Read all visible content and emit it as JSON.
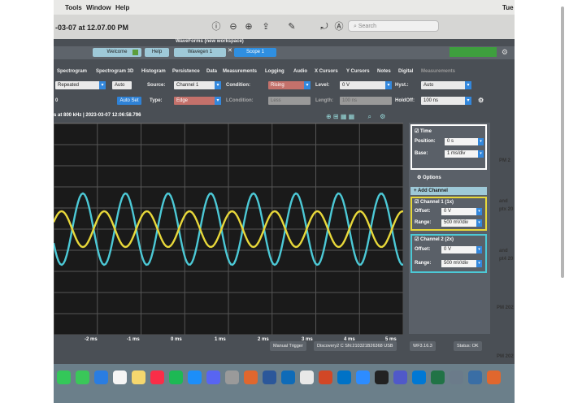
{
  "mac_menubar": {
    "items": [
      "Tools",
      "Window",
      "Help"
    ],
    "clock": "Tue"
  },
  "window": {
    "title": "-03-07 at 12.07.00 PM",
    "search_placeholder": "Search"
  },
  "app": {
    "workspace_title": "WaveForms (new workspace)",
    "tabs": [
      {
        "label": "Welcome"
      },
      {
        "label": "Help"
      },
      {
        "label": "Wavegen 1"
      },
      {
        "label": "Scope 1"
      }
    ],
    "menu": [
      "Spectrogram",
      "Spectrogram 3D",
      "Histogram",
      "Persistence",
      "Data",
      "Measurements",
      "Logging",
      "Audio",
      "X Cursors",
      "Y Cursors",
      "Notes",
      "Digital",
      "Measurements"
    ],
    "trigger_row1": {
      "mode": "Repeated",
      "auto": "Auto",
      "source_label": "Source:",
      "source": "Channel 1",
      "condition_label": "Condition:",
      "condition": "Rising",
      "level_label": "Level:",
      "level": "0 V",
      "hyst_label": "Hyst.:",
      "hyst": "Auto"
    },
    "trigger_row2": {
      "left_value": "0",
      "autoset": "Auto Set",
      "type_label": "Type:",
      "type": "Edge",
      "lcondition_label": "LCondition:",
      "lcondition": "Less",
      "length_label": "Length:",
      "length": "100 ns",
      "holdoff_label": "HoldOff:",
      "holdoff": "100 ns"
    },
    "status_line": "s at 800 kHz | 2023-03-07 12:06:58.796",
    "x_ticks": [
      "-2 ms",
      "-1 ms",
      "0 ms",
      "1 ms",
      "2 ms",
      "3 ms",
      "4 ms",
      "5 ms"
    ],
    "time_panel": {
      "title": "Time",
      "position_label": "Position:",
      "position": "0 s",
      "base_label": "Base:",
      "base": "1 ms/div"
    },
    "options_label": "Options",
    "add_channel_label": "Add Channel",
    "channel1": {
      "title": "Channel 1 (1x)",
      "offset_label": "Offset:",
      "offset": "0 V",
      "range_label": "Range:",
      "range": "500 mV/div",
      "color": "#e8d83a"
    },
    "channel2": {
      "title": "Channel 2 (2x)",
      "offset_label": "Offset:",
      "offset": "0 V",
      "range_label": "Range:",
      "range": "500 mV/div",
      "color": "#4cc9d6"
    },
    "bottom_status": {
      "trigger": "Manual Trigger",
      "device": "Discovery2 C SN:210321B26368 USB",
      "version": "WF3.16.3",
      "status": "Status: OK"
    }
  },
  "right_fragments": [
    "PM 2",
    "and",
    "ptx 20",
    "and",
    "pt4 20",
    "PM 202",
    "PM 202"
  ],
  "dock_icons": [
    "messages-icon",
    "facetime-icon",
    "finder-icon",
    "calendar-icon",
    "notes-icon",
    "music-icon",
    "spotify-icon",
    "appstore-icon",
    "discord-icon",
    "settings-icon",
    "matlab-icon",
    "word-icon",
    "vscode-icon",
    "chrome-icon",
    "powerpoint-icon",
    "outlook-icon",
    "zoom-icon",
    "github-icon",
    "teams-icon",
    "outlook2-icon",
    "excel-icon",
    "files-icon",
    "waveforms-icon",
    "matlab2-icon"
  ]
}
